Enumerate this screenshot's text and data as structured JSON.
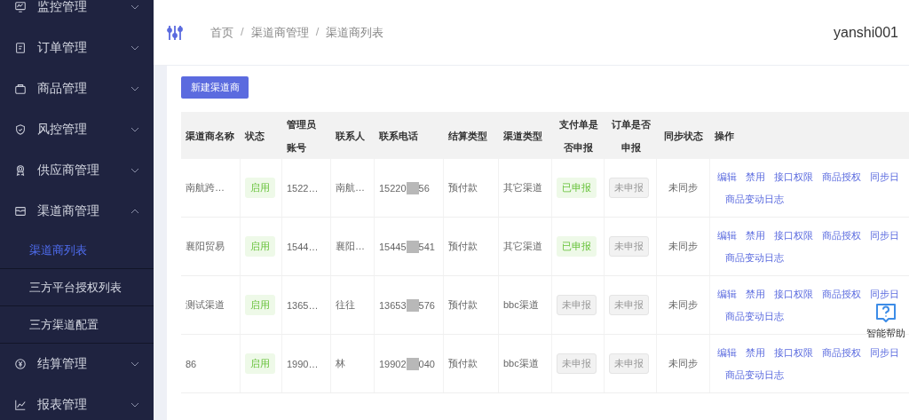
{
  "sidebar": {
    "items": [
      {
        "label": "监控管理",
        "expanded": false
      },
      {
        "label": "订单管理",
        "expanded": false
      },
      {
        "label": "商品管理",
        "expanded": false
      },
      {
        "label": "风控管理",
        "expanded": false
      },
      {
        "label": "供应商管理",
        "expanded": false
      },
      {
        "label": "渠道商管理",
        "expanded": true,
        "children": [
          {
            "label": "渠道商列表",
            "selected": true
          },
          {
            "label": "三方平台授权列表",
            "selected": false
          },
          {
            "label": "三方渠道配置",
            "selected": false
          }
        ]
      },
      {
        "label": "结算管理",
        "expanded": false
      },
      {
        "label": "报表管理",
        "expanded": false
      }
    ]
  },
  "header": {
    "breadcrumb": [
      "首页",
      "渠道商管理",
      "渠道商列表"
    ],
    "separator": "/",
    "user": "yanshi001"
  },
  "new_button": "新建渠道商",
  "table": {
    "columns": [
      "渠道商名称",
      "状态",
      "管理员账号",
      "联系人",
      "联系电话",
      "结算类型",
      "渠道类型",
      "支付单是否申报",
      "订单是否申报",
      "同步状态",
      "操作"
    ],
    "rows": [
      {
        "name": "南航跨…",
        "status": "启用",
        "enabled": true,
        "admin": "1522…",
        "contact": "南航…",
        "phone_start": "15220",
        "phone_end": "56",
        "settle": "预付款",
        "type": "其它渠道",
        "pay": "已申报",
        "pay_declared": true,
        "order": "未申报",
        "order_declared": false,
        "sync": "未同步",
        "actions": [
          "编辑",
          "禁用",
          "接口权限",
          "商品授权",
          "同步日",
          "商品变动日志"
        ]
      },
      {
        "name": "襄阳贸易",
        "status": "启用",
        "enabled": true,
        "admin": "1544…",
        "contact": "襄阳…",
        "phone_start": "15445",
        "phone_end": "541",
        "settle": "预付款",
        "type": "其它渠道",
        "pay": "已申报",
        "pay_declared": true,
        "order": "未申报",
        "order_declared": false,
        "sync": "未同步",
        "actions": [
          "编辑",
          "禁用",
          "接口权限",
          "商品授权",
          "同步日",
          "商品变动日志"
        ]
      },
      {
        "name": "测试渠道",
        "status": "启用",
        "enabled": true,
        "admin": "1365…",
        "contact": "往往",
        "phone_start": "13653",
        "phone_end": "576",
        "settle": "预付款",
        "type": "bbc渠道",
        "pay": "未申报",
        "pay_declared": false,
        "order": "未申报",
        "order_declared": false,
        "sync": "未同步",
        "actions": [
          "编辑",
          "禁用",
          "接口权限",
          "商品授权",
          "同步日",
          "商品变动日志"
        ]
      },
      {
        "name": "86",
        "status": "启用",
        "enabled": true,
        "admin": "1990…",
        "contact": "林",
        "phone_start": "19902",
        "phone_end": "040",
        "settle": "预付款",
        "type": "bbc渠道",
        "pay": "未申报",
        "pay_declared": false,
        "order": "未申报",
        "order_declared": false,
        "sync": "未同步",
        "actions": [
          "编辑",
          "禁用",
          "接口权限",
          "商品授权",
          "同步日",
          "商品变动日志"
        ]
      }
    ]
  },
  "help": {
    "label": "智能帮助"
  }
}
